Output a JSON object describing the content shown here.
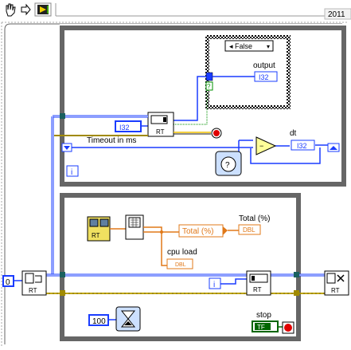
{
  "toolbar": {
    "tools": [
      "hand-tool-icon",
      "arrow-tool-icon",
      "run-tool-icon"
    ],
    "version": "2011"
  },
  "top_loop": {
    "case_selector": "False",
    "output_label": "output",
    "timeout_label": "Timeout in ms",
    "dt_label": "dt",
    "i_label": "i",
    "type_i32": "I32",
    "rt_label": "RT"
  },
  "bottom_loop": {
    "total_label": "Total (%)",
    "total_node_text": "Total (%)",
    "cpu_label": "cpu load",
    "dbl_label": "DBL",
    "i_label": "i",
    "wait_value": "100",
    "stop_label": "stop",
    "stop_tf": "TF",
    "rt_label": "RT"
  },
  "left_constant": "0",
  "colors": {
    "loop_frame": "#666666",
    "wire_blue": "#1a3cff",
    "wire_int": "#2a6fff",
    "wire_orange": "#e07818",
    "wire_rt": "#a08a00",
    "bool_green": "#006600"
  }
}
